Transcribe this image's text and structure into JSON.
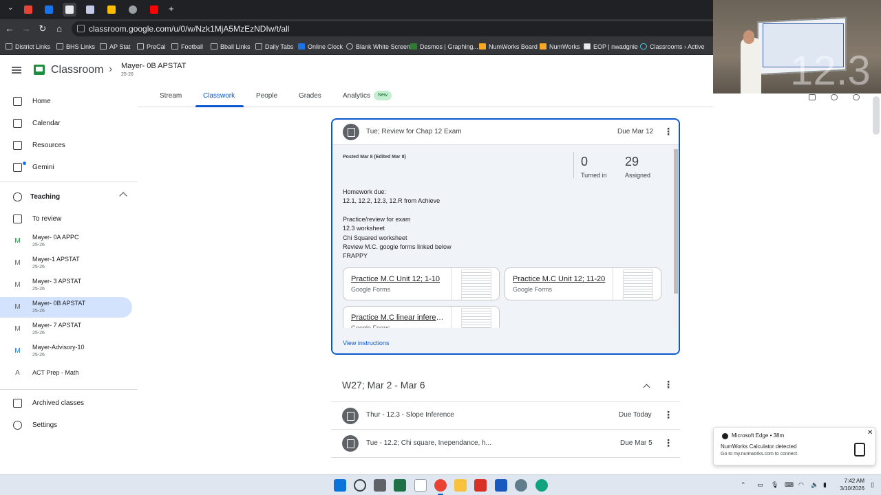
{
  "browser": {
    "url": "classroom.google.com/u/0/w/Nzk1MjA5MzEzNDIw/t/all",
    "bookmarks": [
      "District Links",
      "BHS Links",
      "AP Stat",
      "PreCal",
      "Football",
      "Bball Links",
      "Daily Tabs",
      "Online Clock",
      "Blank White Screen",
      "Desmos | Graphing...",
      "NumWorks Board",
      "NumWorks",
      "EOP | nwadgnie",
      "Classrooms › Active"
    ]
  },
  "header": {
    "app_name": "Classroom",
    "class_name": "Mayer- 0B APSTAT",
    "class_sub": "25-26"
  },
  "sidebar": {
    "home": "Home",
    "calendar": "Calendar",
    "resources": "Resources",
    "gemini": "Gemini",
    "teaching": "Teaching",
    "to_review": "To review",
    "classes": [
      {
        "avatar": "M",
        "name": "Mayer- 0A APPC",
        "sub": "25-26",
        "color": "#1e8e3e"
      },
      {
        "avatar": "M",
        "name": "Mayer-1 APSTAT",
        "sub": "25-26",
        "color": "#5f6368"
      },
      {
        "avatar": "M",
        "name": "Mayer- 3 APSTAT",
        "sub": "25-26",
        "color": "#5f6368"
      },
      {
        "avatar": "M",
        "name": "Mayer- 0B APSTAT",
        "sub": "25-26",
        "color": "#5f6368"
      },
      {
        "avatar": "M",
        "name": "Mayer- 7 APSTAT",
        "sub": "25-26",
        "color": "#5f6368"
      },
      {
        "avatar": "M",
        "name": "Mayer-Advisory-10",
        "sub": "25-26",
        "color": "#1a73e8"
      },
      {
        "avatar": "A",
        "name": "ACT Prep - Math",
        "sub": "",
        "color": "#5f6368"
      }
    ],
    "archived": "Archived classes",
    "settings": "Settings"
  },
  "tabs": [
    "Stream",
    "Classwork",
    "People",
    "Grades",
    "Analytics"
  ],
  "new_badge": "New",
  "assignment": {
    "title": "Tue; Review for Chap 12 Exam",
    "due": "Due Mar 12",
    "posted": "Posted Mar 8 (Edited Mar 8)",
    "turned_in_count": "0",
    "turned_in_label": "Turned in",
    "assigned_count": "29",
    "assigned_label": "Assigned",
    "instructions": [
      "Homework due:",
      "12.1, 12.2, 12.3, 12.R from Achieve",
      "Practice/review for exam",
      "12.3 worksheet",
      "Chi Squared worksheet",
      "Review M.C. google forms linked below",
      "FRAPPY"
    ],
    "materials": [
      {
        "title": "Practice M.C Unit 12; 1-10",
        "type": "Google Forms"
      },
      {
        "title": "Practice M.C Unit 12; 11-20",
        "type": "Google Forms"
      },
      {
        "title": "Practice M.C linear inference",
        "type": "Google Forms"
      }
    ],
    "view_instructions": "View instructions"
  },
  "week": {
    "title": "W27; Mar 2 - Mar 6",
    "items": [
      {
        "title": "Thur - 12.3 - Slope Inference",
        "due": "Due Today"
      },
      {
        "title": "Tue - 12.2; Chi square, Inependance, h...",
        "due": "Due Mar 5"
      }
    ]
  },
  "webcam": {
    "overlay_text": "12.3"
  },
  "toast": {
    "app": "Microsoft Edge • 38m",
    "line1": "NumWorks Calculator detected",
    "line2": "Go to my.numworks.com to connect."
  },
  "clock": {
    "time": "7:42 AM",
    "date": "3/10/2026"
  }
}
